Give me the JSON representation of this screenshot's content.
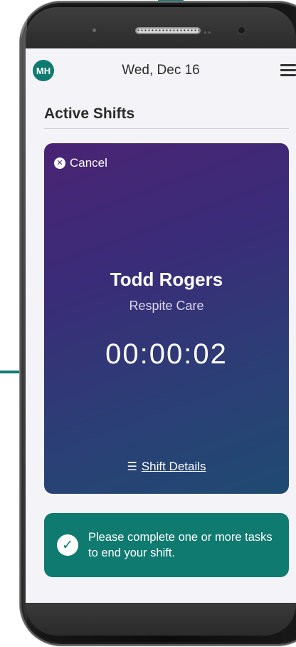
{
  "header": {
    "avatar_initials": "MH",
    "date": "Wed, Dec 16"
  },
  "section": {
    "title": "Active Shifts"
  },
  "shift_card": {
    "cancel_label": "Cancel",
    "client_name": "Todd Rogers",
    "care_type": "Respite Care",
    "timer": "00:00:02",
    "details_label": "Shift Details"
  },
  "task_banner": {
    "message": "Please complete one or more tasks to end your shift."
  },
  "colors": {
    "teal": "#0f7a70",
    "card_gradient_start": "#4a2474",
    "card_gradient_end": "#1f4a72"
  }
}
